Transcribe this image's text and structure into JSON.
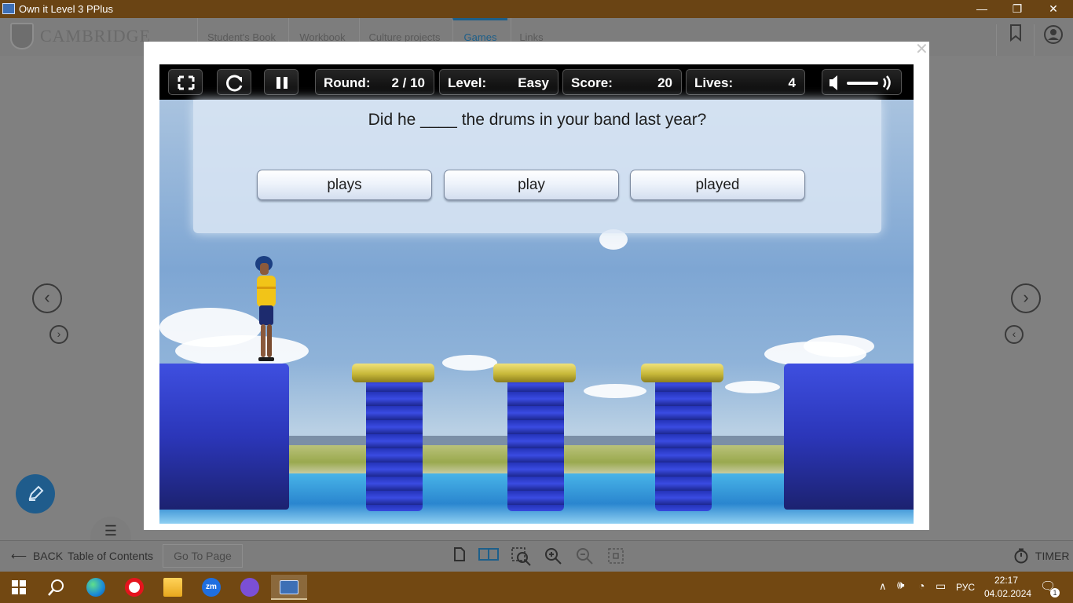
{
  "window": {
    "title": "Own it Level 3 PPlus",
    "minimize": "—",
    "restore": "❐",
    "close": "✕"
  },
  "header": {
    "logo_text": "CAMBRIDGE",
    "tabs": [
      {
        "label": "Student's Book"
      },
      {
        "label": "Workbook"
      },
      {
        "label": "Culture projects"
      },
      {
        "label": "Games"
      },
      {
        "label": "Links"
      }
    ],
    "active_tab": "Games"
  },
  "game": {
    "round_label": "Round:",
    "round_value": "2 / 10",
    "level_label": "Level:",
    "level_value": "Easy",
    "score_label": "Score:",
    "score_value": "20",
    "lives_label": "Lives:",
    "lives_value": "4",
    "question": "Did he ____ the drums in your band last year?",
    "answers": [
      "plays",
      "play",
      "played"
    ]
  },
  "footer": {
    "back_label": "BACK",
    "toc_label": "Table of Contents",
    "goto_label": "Go To Page",
    "timer_label": "TIMER"
  },
  "taskbar": {
    "apps": [
      "windows-start",
      "search",
      "edge",
      "opera",
      "file-explorer",
      "zoom",
      "viber",
      "pplus"
    ],
    "lang": "РУС",
    "time": "22:17",
    "date": "04.02.2024",
    "notification_count": "1"
  },
  "colors": {
    "titlebar": "#6a4414",
    "taskbar": "#724812",
    "accent": "#1d5f8a",
    "pen_button": "#1f5c8c"
  }
}
